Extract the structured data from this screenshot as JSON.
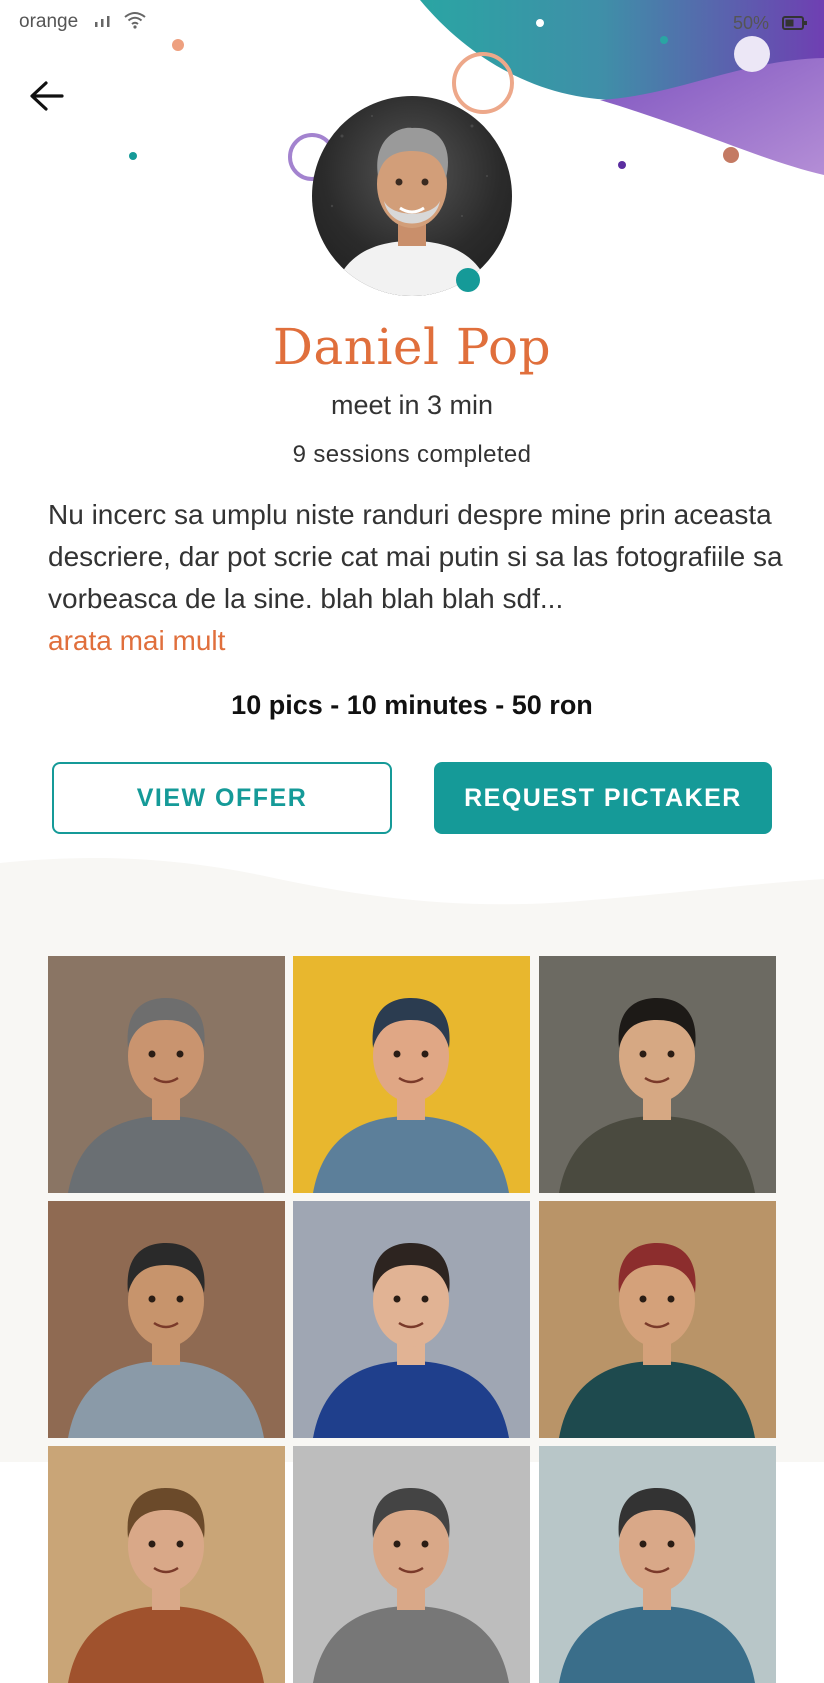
{
  "status_bar": {
    "carrier": "orange",
    "battery": "50%"
  },
  "profile": {
    "name": "Daniel Pop",
    "meet": "meet in 3 min",
    "sessions": "9 sessions completed",
    "description": "Nu incerc sa umplu niste randuri despre mine prin aceasta descriere, dar pot scrie cat mai putin si sa las fotografiile sa vorbeasca de la sine. blah blah blah sdf...",
    "show_more": "arata mai mult",
    "offer_summary": "10 pics - 10 minutes - 50 ron"
  },
  "actions": {
    "view_offer": "VIEW OFFER",
    "request": "REQUEST PICTAKER"
  },
  "colors": {
    "accent": "#e06f3c",
    "teal": "#159a98",
    "purple": "#6a3fb0",
    "gallery_bg": "#f8f7f4"
  },
  "icons": {
    "back": "arrow-left-icon",
    "signal": "signal-icon",
    "wifi": "wifi-icon",
    "battery": "battery-icon"
  },
  "gallery": [
    {
      "name": "bearded-man-glasses",
      "bg": "#8a7564",
      "skin": "#c9946f",
      "hair": "#6e6e6e",
      "shirt": "#6a6f73"
    },
    {
      "name": "woman-yellow-wall",
      "bg": "#e8b72e",
      "skin": "#e0a785",
      "hair": "#2b3c50",
      "shirt": "#5c7f9a"
    },
    {
      "name": "man-holding-model",
      "bg": "#6c6a62",
      "skin": "#d6a883",
      "hair": "#1d1a17",
      "shirt": "#4a4a3f"
    },
    {
      "name": "man-surprised-grill",
      "bg": "#8f6a52",
      "skin": "#c7946c",
      "hair": "#2a2a2a",
      "shirt": "#8a9aa8"
    },
    {
      "name": "man-with-camera",
      "bg": "#9fa6b3",
      "skin": "#e1b394",
      "hair": "#2d2420",
      "shirt": "#1f3f8c"
    },
    {
      "name": "man-red-beanie",
      "bg": "#b99468",
      "skin": "#d4a17a",
      "hair": "#8c2d2d",
      "shirt": "#1e4a4e"
    },
    {
      "name": "photo-row3-1",
      "bg": "#c9a577",
      "skin": "#d9a888",
      "hair": "#6b4a2a",
      "shirt": "#a0522d"
    },
    {
      "name": "photo-row3-2",
      "bg": "#bdbdbd",
      "skin": "#d9a888",
      "hair": "#444",
      "shirt": "#777"
    },
    {
      "name": "photo-row3-3",
      "bg": "#b8c6c8",
      "skin": "#d9a888",
      "hair": "#333",
      "shirt": "#3a6e8a"
    }
  ]
}
